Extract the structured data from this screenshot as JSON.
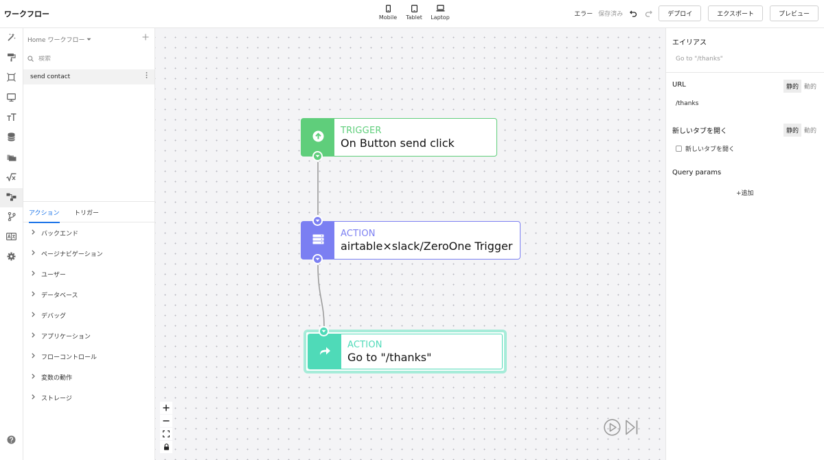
{
  "topbar": {
    "title": "ワークフロー",
    "devices": [
      {
        "label": "Mobile",
        "icon": "mobile-icon"
      },
      {
        "label": "Tablet",
        "icon": "tablet-icon"
      },
      {
        "label": "Laptop",
        "icon": "laptop-icon"
      }
    ],
    "error_label": "エラー",
    "saved_label": "保存済み",
    "deploy_label": "デプロイ",
    "export_label": "エクスポート",
    "preview_label": "プレビュー"
  },
  "rail": {
    "icons": [
      "magic-wand-icon",
      "paint-roller-icon",
      "frame-icon",
      "monitor-icon",
      "typography-icon",
      "database-icon",
      "folders-icon",
      "formula-icon",
      "workflow-icon",
      "git-branch-icon",
      "language-icon",
      "settings-icon"
    ],
    "active": "workflow-icon",
    "help_icon": "help-icon"
  },
  "left_panel": {
    "breadcrumb": "Home ワークフロー",
    "search_placeholder": "検索",
    "workflows": [
      "send contact"
    ],
    "tabs": [
      "アクション",
      "トリガー"
    ],
    "active_tab": "アクション",
    "categories": [
      "バックエンド",
      "ページナビゲーション",
      "ユーザー",
      "データベース",
      "デバッグ",
      "アプリケーション",
      "フローコントロール",
      "変数の動作",
      "ストレージ"
    ]
  },
  "canvas": {
    "nodes": [
      {
        "kind": "TRIGGER",
        "title": "On Button send click",
        "color": "#5fce7b",
        "icon": "upload-arrow-icon"
      },
      {
        "kind": "ACTION",
        "title": "airtable×slack/ZeroOne Trigger",
        "color": "#7b7ff2",
        "icon": "server-icon"
      },
      {
        "kind": "ACTION",
        "title": "Go to \"/thanks\"",
        "color": "#4fdab8",
        "icon": "redirect-arrow-icon",
        "selected": true
      }
    ],
    "controls": [
      "zoom-in-icon",
      "zoom-out-icon",
      "fit-view-icon",
      "lock-icon"
    ],
    "playback": [
      "play-icon",
      "step-forward-icon"
    ]
  },
  "right_panel": {
    "alias_title": "エイリアス",
    "alias_placeholder": "Go to \"/thanks\"",
    "url_label": "URL",
    "url_value": "/thanks",
    "static_label": "静的",
    "dynamic_label": "動的",
    "new_tab_label": "新しいタブを開く",
    "new_tab_checkbox": "新しいタブを開く",
    "new_tab_checked": false,
    "query_params_label": "Query params",
    "add_label": "+追加"
  }
}
